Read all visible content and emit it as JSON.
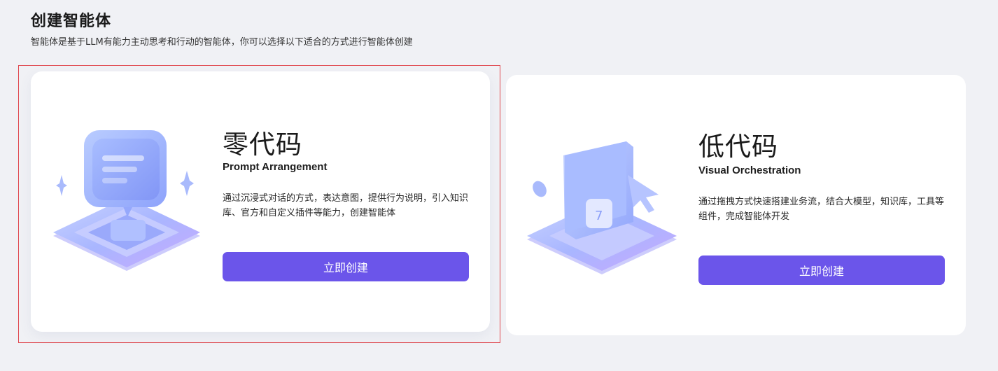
{
  "header": {
    "title": "创建智能体",
    "subtitle": "智能体是基于LLM有能力主动思考和行动的智能体，你可以选择以下适合的方式进行智能体创建"
  },
  "cards": [
    {
      "title": "零代码",
      "subtitle": "Prompt Arrangement",
      "description": "通过沉浸式对话的方式，表达意图，提供行为说明，引入知识库、官方和自定义插件等能力，创建智能体",
      "button_label": "立即创建",
      "icon": "chat-bubble-illustration",
      "selected": true
    },
    {
      "title": "低代码",
      "subtitle": "Visual Orchestration",
      "description": "通过拖拽方式快速搭建业务流，结合大模型，知识库，工具等组件，完成智能体开发",
      "button_label": "立即创建",
      "icon": "workflow-canvas-illustration",
      "selected": false
    }
  ],
  "colors": {
    "accent": "#6b55ea",
    "background": "#f0f1f5",
    "card": "#ffffff",
    "selection_border": "#e0484f"
  }
}
